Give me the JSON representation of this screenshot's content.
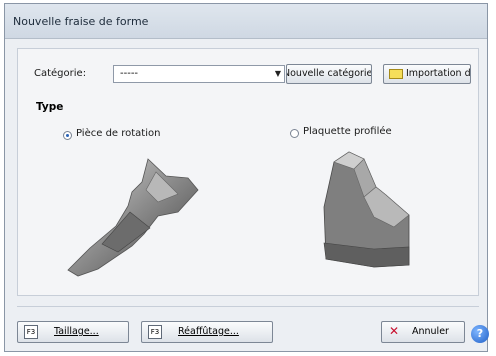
{
  "window": {
    "title": "Nouvelle fraise de forme"
  },
  "category": {
    "label": "Catégorie:",
    "value": "-----",
    "new_button": "Nouvelle catégorie...",
    "import_button": "Importation des..."
  },
  "type": {
    "title": "Type",
    "options": [
      {
        "label": "Pièce de rotation",
        "selected": true
      },
      {
        "label": "Plaquette profilée",
        "selected": false
      }
    ]
  },
  "footer": {
    "cut_key": "F3",
    "cut_label": "Taillage...",
    "regrind_key": "F3",
    "regrind_label": "Réaffûtage...",
    "cancel_label": "Annuler",
    "help_glyph": "?"
  }
}
